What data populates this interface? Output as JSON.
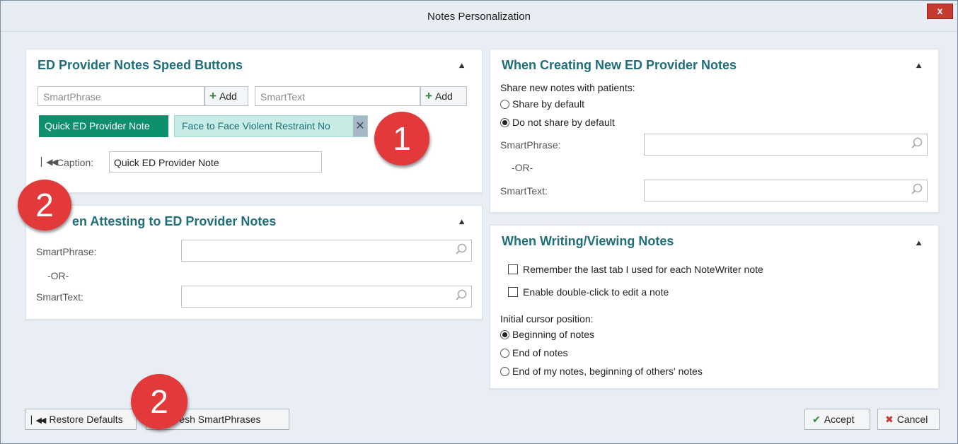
{
  "window": {
    "title": "Notes Personalization",
    "close_label": "x"
  },
  "speed_buttons": {
    "title": "ED Provider Notes Speed Buttons",
    "smartphrase_placeholder": "SmartPhrase",
    "smarttext_placeholder": "SmartText",
    "add_label": "Add",
    "chips": [
      "Quick ED Provider Note",
      "Face to Face Violent Restraint No"
    ],
    "caption_label": "Caption:",
    "caption_value": "Quick ED Provider Note"
  },
  "attesting": {
    "title": "en Attesting to ED Provider Notes",
    "smartphrase_label": "SmartPhrase:",
    "or_label": "-OR-",
    "smarttext_label": "SmartText:"
  },
  "creating": {
    "title": "When Creating New ED Provider Notes",
    "share_heading": "Share new notes with patients:",
    "options": [
      "Share by default",
      "Do not share by default"
    ],
    "selected_index": 1,
    "smartphrase_label": "SmartPhrase:",
    "or_label": "-OR-",
    "smarttext_label": "SmartText:"
  },
  "writing": {
    "title": "When Writing/Viewing Notes",
    "checks": [
      "Remember the last tab I used for each NoteWriter note",
      "Enable double-click to edit a note"
    ],
    "cursor_heading": "Initial cursor position:",
    "cursor_options": [
      "Beginning of notes",
      "End of notes",
      "End of my notes, beginning of others' notes"
    ],
    "selected_index": 0
  },
  "footer": {
    "restore_label": "Restore Defaults",
    "refresh_label": "efresh SmartPhrases",
    "accept_label": "Accept",
    "cancel_label": "Cancel"
  },
  "annotations": [
    "1",
    "2",
    "2"
  ],
  "colors": {
    "accent_teal": "#1f6e7a",
    "chip_green": "#0e8f6e",
    "chip_light": "#c7ece6",
    "badge_red": "#e23a3a"
  }
}
